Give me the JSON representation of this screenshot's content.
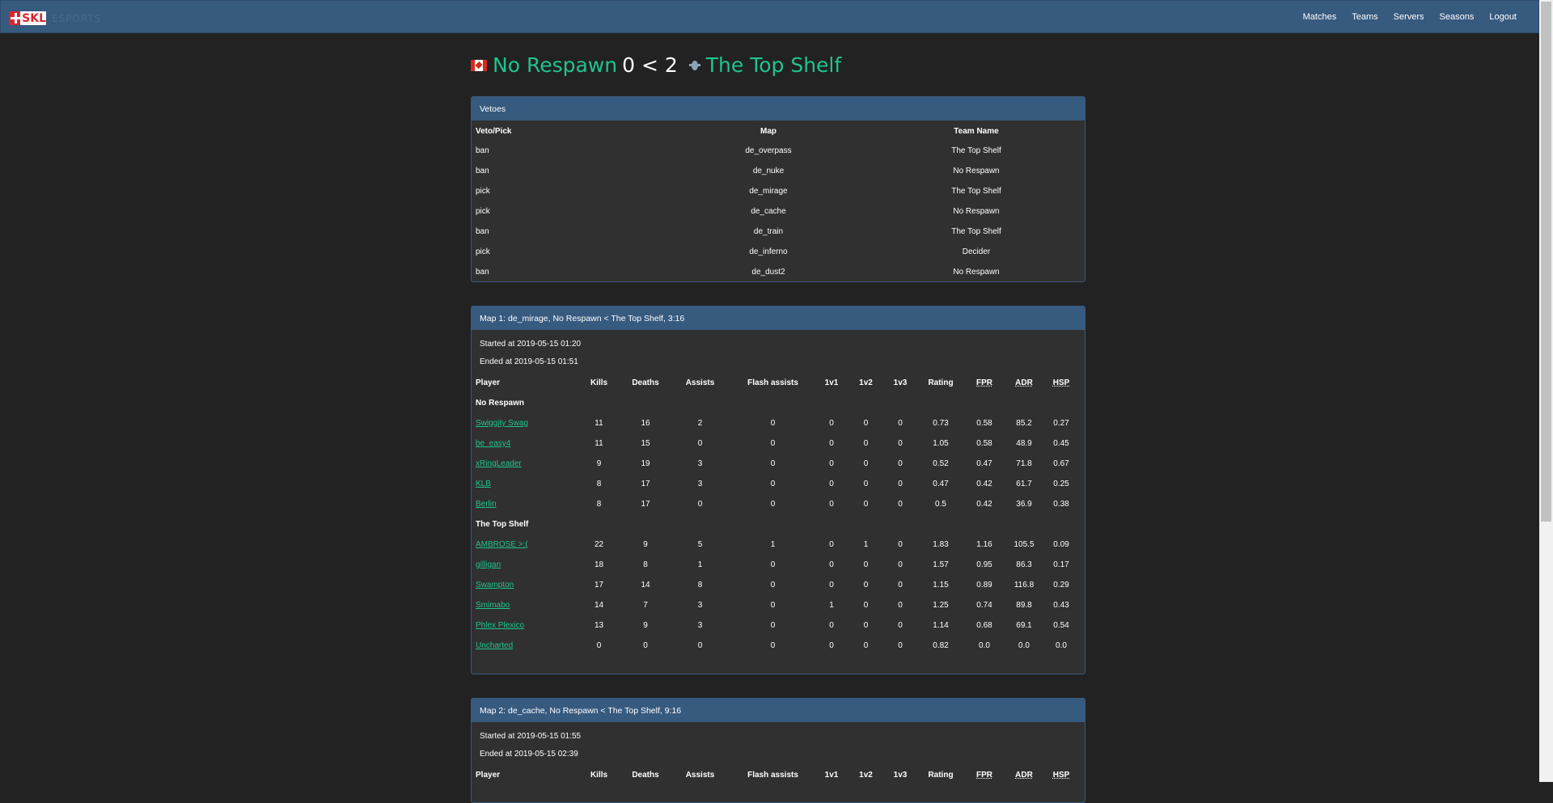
{
  "navbar": {
    "brand_logo_text": "SKL",
    "brand_sub": "ESPORTS",
    "links": [
      "Matches",
      "Teams",
      "Servers",
      "Seasons",
      "Logout"
    ]
  },
  "match": {
    "team1": "No Respawn",
    "score1": "0",
    "separator": "<",
    "score2": "2",
    "team2": "The Top Shelf"
  },
  "vetoes": {
    "heading": "Vetoes",
    "columns": [
      "Veto/Pick",
      "Map",
      "Team Name"
    ],
    "rows": [
      [
        "ban",
        "de_overpass",
        "The Top Shelf"
      ],
      [
        "ban",
        "de_nuke",
        "No Respawn"
      ],
      [
        "pick",
        "de_mirage",
        "The Top Shelf"
      ],
      [
        "pick",
        "de_cache",
        "No Respawn"
      ],
      [
        "ban",
        "de_train",
        "The Top Shelf"
      ],
      [
        "pick",
        "de_inferno",
        "Decider"
      ],
      [
        "ban",
        "de_dust2",
        "No Respawn"
      ]
    ]
  },
  "stat_columns": [
    "Player",
    "Kills",
    "Deaths",
    "Assists",
    "Flash assists",
    "1v1",
    "1v2",
    "1v3",
    "Rating",
    "FPR",
    "ADR",
    "HSP"
  ],
  "maps": [
    {
      "heading": "Map 1: de_mirage, No Respawn < The Top Shelf, 3:16",
      "started": "Started at 2019-05-15 01:20",
      "ended": "Ended at 2019-05-15 01:51",
      "teams": [
        {
          "name": "No Respawn",
          "players": [
            [
              "Swiggity Swag",
              "11",
              "16",
              "2",
              "0",
              "0",
              "0",
              "0",
              "0.73",
              "0.58",
              "85.2",
              "0.27"
            ],
            [
              "be_easy4",
              "11",
              "15",
              "0",
              "0",
              "0",
              "0",
              "0",
              "1.05",
              "0.58",
              "48.9",
              "0.45"
            ],
            [
              "xRingLeader",
              "9",
              "19",
              "3",
              "0",
              "0",
              "0",
              "0",
              "0.52",
              "0.47",
              "71.8",
              "0.67"
            ],
            [
              "KLB",
              "8",
              "17",
              "3",
              "0",
              "0",
              "0",
              "0",
              "0.47",
              "0.42",
              "61.7",
              "0.25"
            ],
            [
              "Berlin",
              "8",
              "17",
              "0",
              "0",
              "0",
              "0",
              "0",
              "0.5",
              "0.42",
              "36.9",
              "0.38"
            ]
          ]
        },
        {
          "name": "The Top Shelf",
          "players": [
            [
              "AMBROSE >:(",
              "22",
              "9",
              "5",
              "1",
              "0",
              "1",
              "0",
              "1.83",
              "1.16",
              "105.5",
              "0.09"
            ],
            [
              "gilligan",
              "18",
              "8",
              "1",
              "0",
              "0",
              "0",
              "0",
              "1.57",
              "0.95",
              "86.3",
              "0.17"
            ],
            [
              "Swampton",
              "17",
              "14",
              "8",
              "0",
              "0",
              "0",
              "0",
              "1.15",
              "0.89",
              "116.8",
              "0.29"
            ],
            [
              "Smimabo",
              "14",
              "7",
              "3",
              "0",
              "1",
              "0",
              "0",
              "1.25",
              "0.74",
              "89.8",
              "0.43"
            ],
            [
              "Phlex Plexico",
              "13",
              "9",
              "3",
              "0",
              "0",
              "0",
              "0",
              "1.14",
              "0.68",
              "69.1",
              "0.54"
            ],
            [
              "Uncharted",
              "0",
              "0",
              "0",
              "0",
              "0",
              "0",
              "0",
              "0.82",
              "0.0",
              "0.0",
              "0.0"
            ]
          ]
        }
      ]
    },
    {
      "heading": "Map 2: de_cache, No Respawn < The Top Shelf, 9:16",
      "started": "Started at 2019-05-15 01:55",
      "ended": "Ended at 2019-05-15 02:39",
      "teams": []
    }
  ]
}
